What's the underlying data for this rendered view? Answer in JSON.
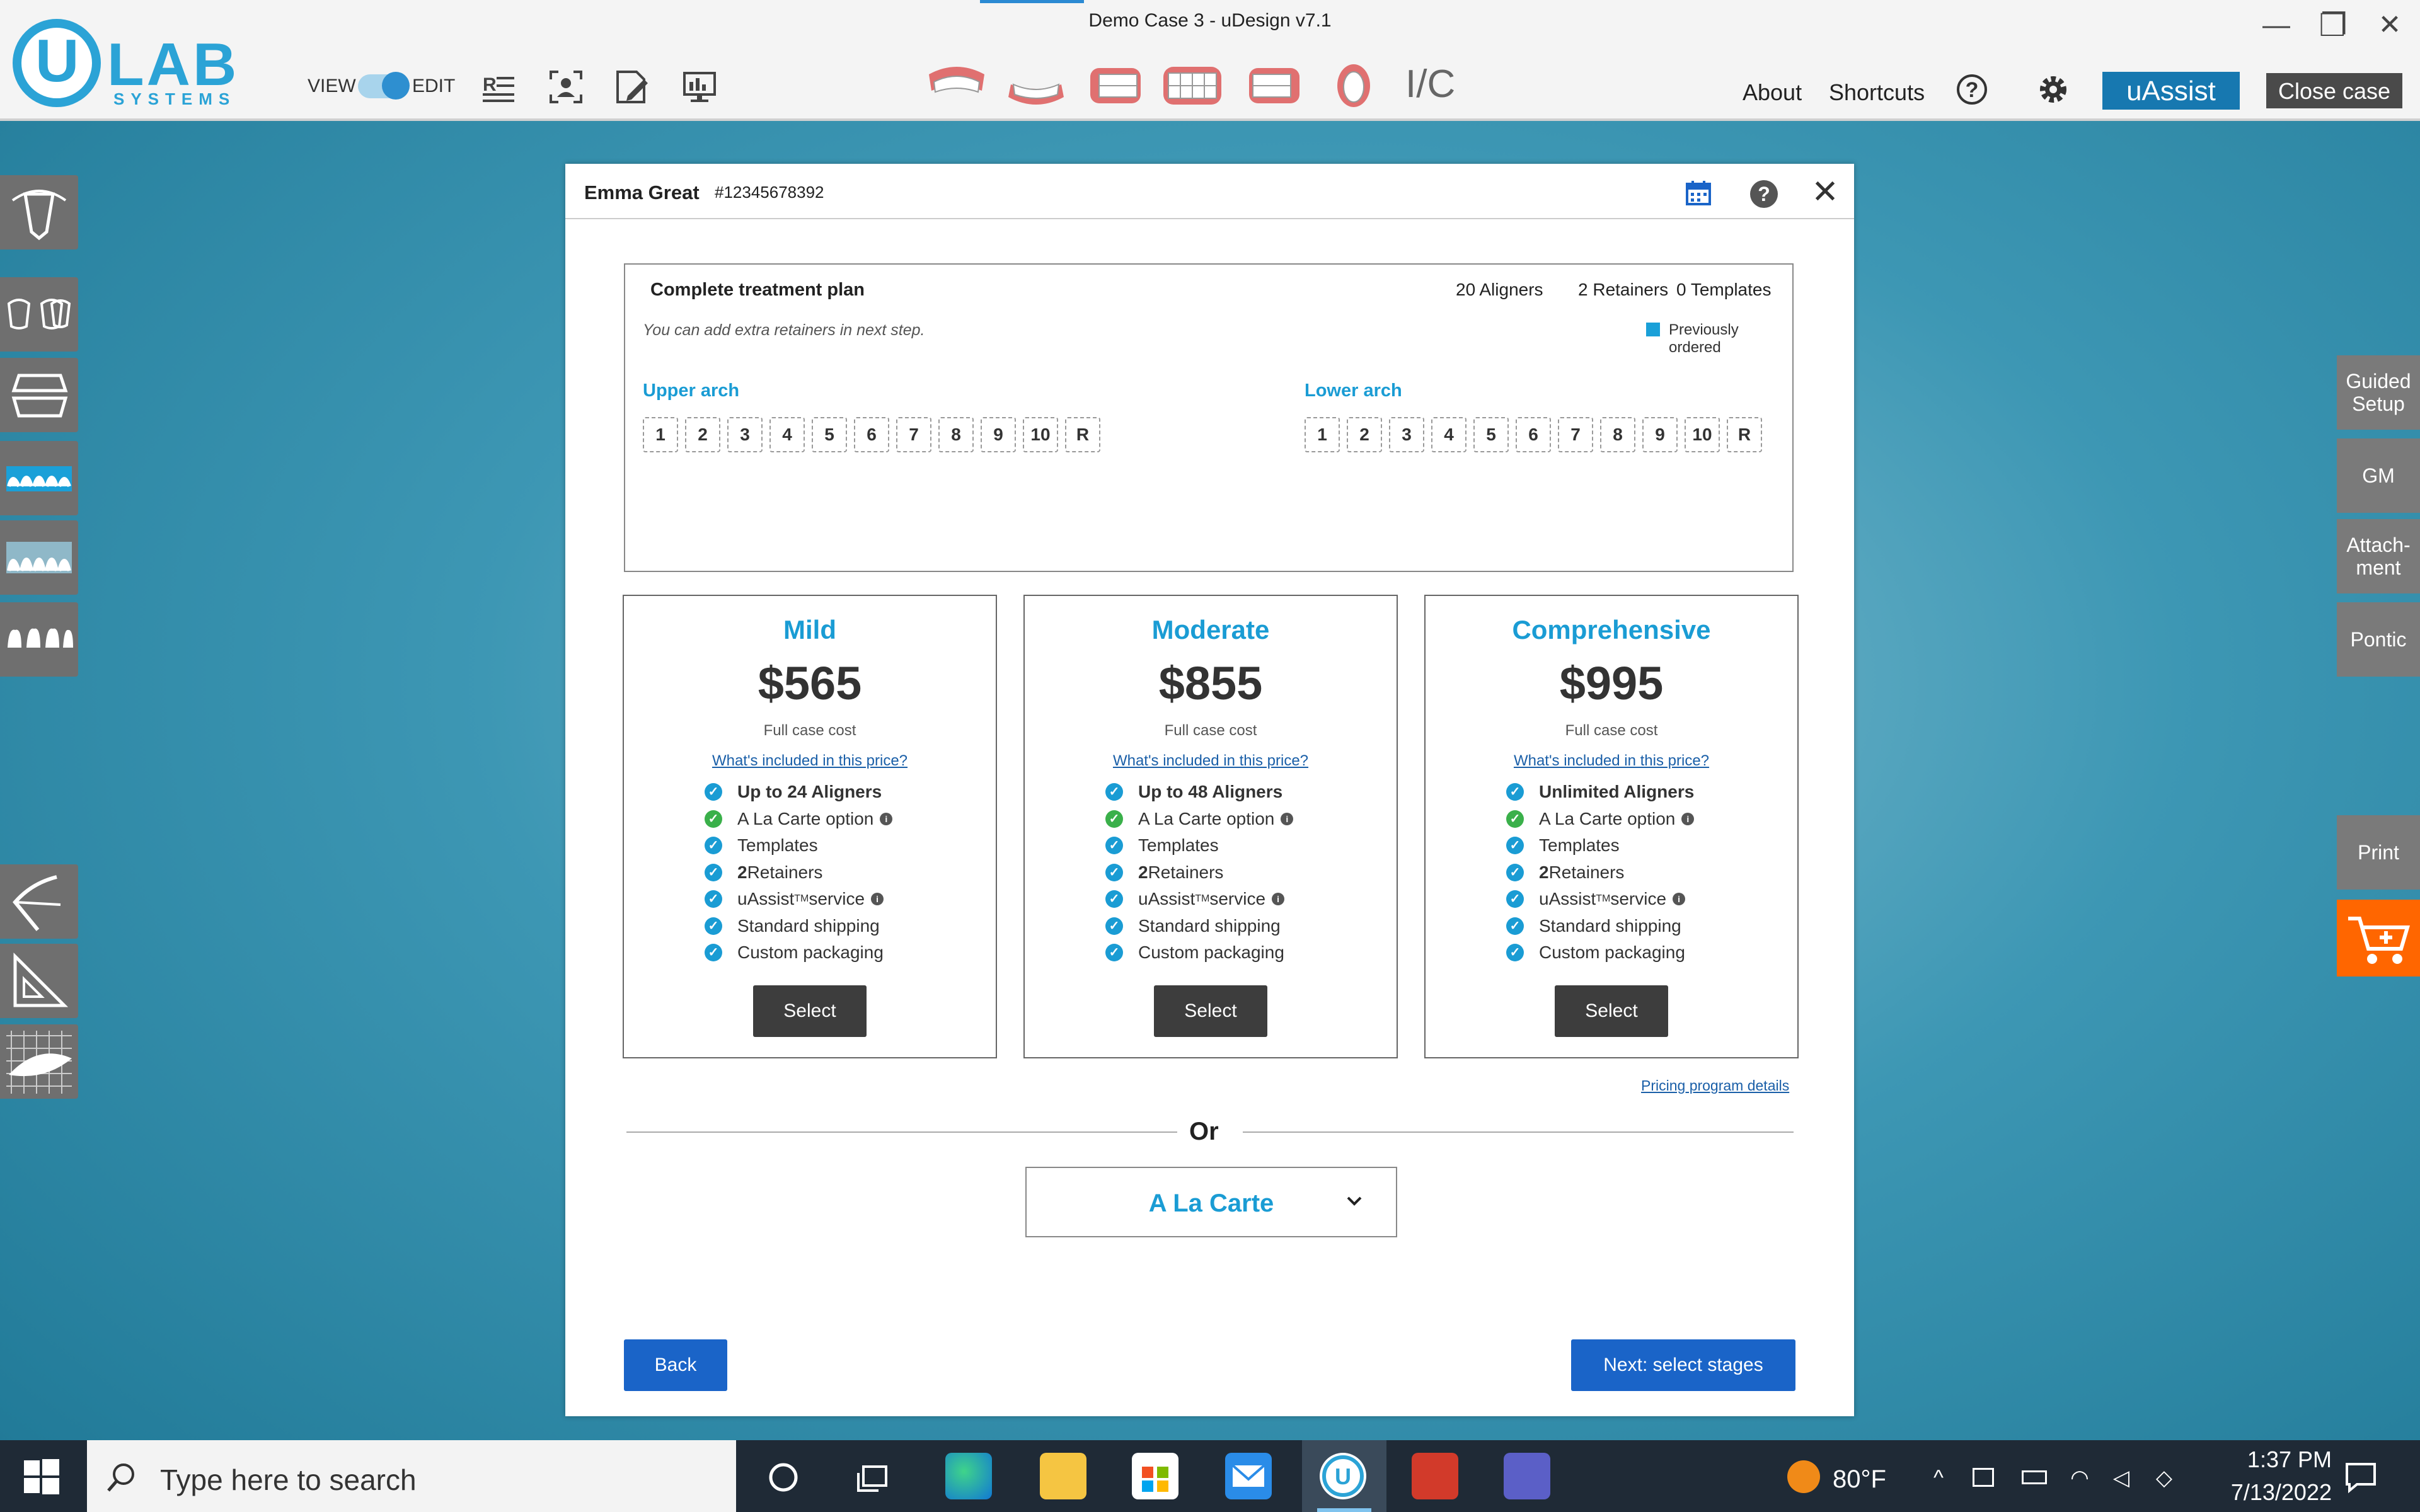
{
  "window": {
    "title": "Demo Case 3 - uDesign v7.1",
    "minimize_icon": "—",
    "maximize_icon": "❐",
    "close_icon": "✕"
  },
  "logo": {
    "u": "U",
    "lab": "LAB",
    "systems": "SYSTEMS"
  },
  "toolbar": {
    "view_label": "VIEW",
    "edit_label": "EDIT",
    "ic_label": "I/C",
    "about": "About",
    "shortcuts": "Shortcuts",
    "help_glyph": "?",
    "uassist": "uAssist",
    "close_case": "Close case"
  },
  "right_tools": {
    "guided_setup": "Guided Setup",
    "gm": "GM",
    "attachment": "Attach-ment",
    "pontic": "Pontic",
    "print": "Print"
  },
  "dialog": {
    "patient_name": "Emma Great",
    "patient_id": "#12345678392",
    "help_glyph": "?",
    "close_glyph": "✕",
    "plan": {
      "title": "Complete treatment plan",
      "aligners": "20 Aligners",
      "retainers": "2 Retainers",
      "templates": "0 Templates",
      "note": "You can add extra retainers in next step.",
      "legend": "Previously ordered",
      "upper_label": "Upper arch",
      "lower_label": "Lower arch",
      "upper_stages": [
        "1",
        "2",
        "3",
        "4",
        "5",
        "6",
        "7",
        "8",
        "9",
        "10",
        "R"
      ],
      "lower_stages": [
        "1",
        "2",
        "3",
        "4",
        "5",
        "6",
        "7",
        "8",
        "9",
        "10",
        "R"
      ]
    },
    "cards": [
      {
        "name": "Mild",
        "price": "$565",
        "sub": "Full case cost",
        "link": "What's included in this price?",
        "f0": "Up to 24 Aligners",
        "f1": "A La Carte option",
        "f2": "Templates",
        "f3a": "2",
        "f3b": " Retainers",
        "f4a": "uAssist",
        "f4tm": "TM",
        "f4b": " service",
        "f5": "Standard shipping",
        "f6": "Custom packaging",
        "button": "Select"
      },
      {
        "name": "Moderate",
        "price": "$855",
        "sub": "Full case cost",
        "link": "What's included in this price?",
        "f0": "Up to 48 Aligners",
        "f1": "A La Carte option",
        "f2": "Templates",
        "f3a": "2",
        "f3b": " Retainers",
        "f4a": "uAssist",
        "f4tm": "TM",
        "f4b": " service",
        "f5": "Standard shipping",
        "f6": "Custom packaging",
        "button": "Select"
      },
      {
        "name": "Comprehensive",
        "price": "$995",
        "sub": "Full case cost",
        "link": "What's included in this price?",
        "f0": "Unlimited Aligners",
        "f1": "A La Carte option",
        "f2": "Templates",
        "f3a": "2",
        "f3b": " Retainers",
        "f4a": "uAssist",
        "f4tm": "TM",
        "f4b": " service",
        "f5": "Standard shipping",
        "f6": "Custom packaging",
        "button": "Select"
      }
    ],
    "pricing_link": "Pricing program details",
    "or": "Or",
    "alacarte": "A La Carte",
    "back": "Back",
    "next": "Next: select stages"
  },
  "taskbar": {
    "search_placeholder": "Type here to search",
    "temperature": "80°F",
    "time": "1:37 PM",
    "date": "7/13/2022"
  },
  "colors": {
    "accent": "#1a9cd4",
    "primary_button": "#1a64c8",
    "check_green": "#3ab04a",
    "cart": "#ff6600"
  }
}
